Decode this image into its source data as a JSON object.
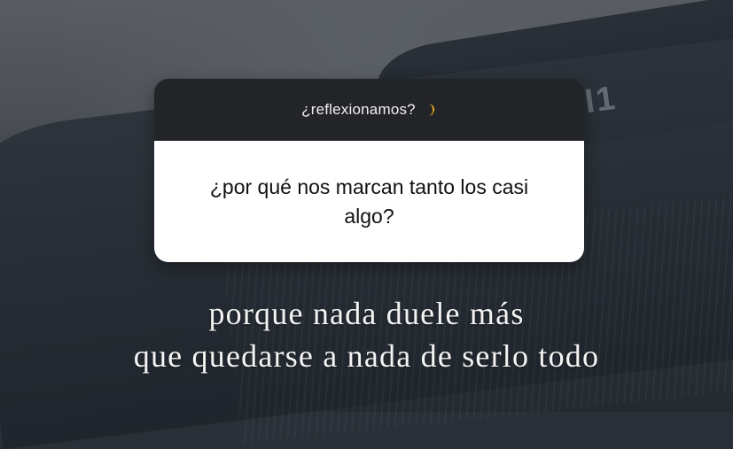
{
  "question_sticker": {
    "prompt": "¿reflexionamos?",
    "prompt_icon": "moon-icon",
    "answer": "¿por qué nos marcan tanto los casi algo?"
  },
  "caption": {
    "lines": [
      "porque nada duele más",
      "que quedarse a nada de serlo todo"
    ]
  },
  "colors": {
    "sticker_header": "#222427",
    "sticker_body": "#ffffff",
    "moon": "#f0b429"
  }
}
